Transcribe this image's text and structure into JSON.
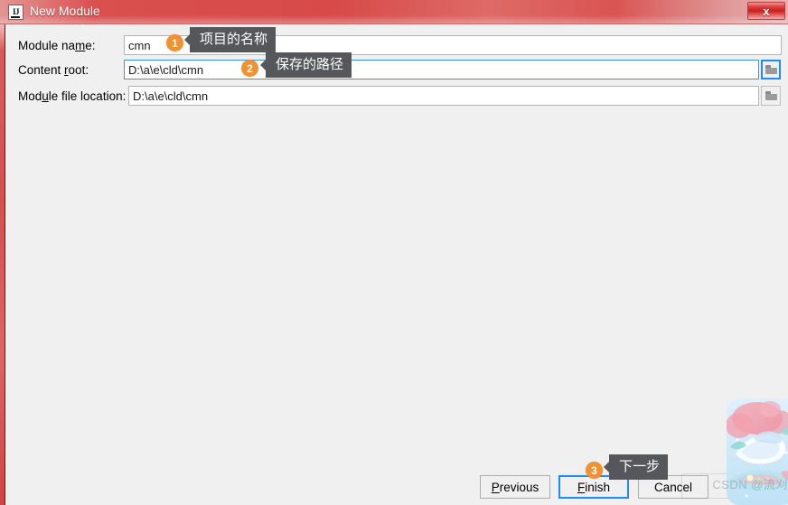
{
  "window": {
    "title": "New Module",
    "app_icon": "intellij-ij-icon",
    "close_label": "x",
    "titlebar_color": "#d74a49",
    "body_color": "#f0f0f0",
    "border_color": "#d64f4f"
  },
  "form": {
    "rows": [
      {
        "label_pre": "Module na",
        "label_mnemonic": "m",
        "label_post": "e:",
        "value": "cmn",
        "focused": false,
        "has_browse": false
      },
      {
        "label_pre": "Content ",
        "label_mnemonic": "r",
        "label_post": "oot:",
        "value": "D:\\a\\e\\cld\\cmn",
        "focused": true,
        "has_browse": true,
        "browse_icon": "folder-icon"
      },
      {
        "label_pre": "Mod",
        "label_mnemonic": "u",
        "label_post": "le file location:",
        "value": "D:\\a\\e\\cld\\cmn",
        "focused": false,
        "has_browse": true,
        "browse_icon": "folder-icon"
      }
    ]
  },
  "buttons": {
    "previous": {
      "pre": "",
      "mnemonic": "P",
      "post": "revious",
      "focused": false
    },
    "finish": {
      "pre": "",
      "mnemonic": "F",
      "post": "inish",
      "focused": true
    },
    "cancel": {
      "pre": "Cancel",
      "mnemonic": "",
      "post": "",
      "focused": false
    }
  },
  "annotations": [
    {
      "number": "1",
      "text": "项目的名称",
      "accent": "#f1912f"
    },
    {
      "number": "2",
      "text": "保存的路径",
      "accent": "#f1912f"
    },
    {
      "number": "3",
      "text": "下一步",
      "accent": "#f1912f"
    }
  ],
  "watermark": {
    "text": "CSDN @流刈",
    "avatar_alt": "anime-avatar"
  }
}
